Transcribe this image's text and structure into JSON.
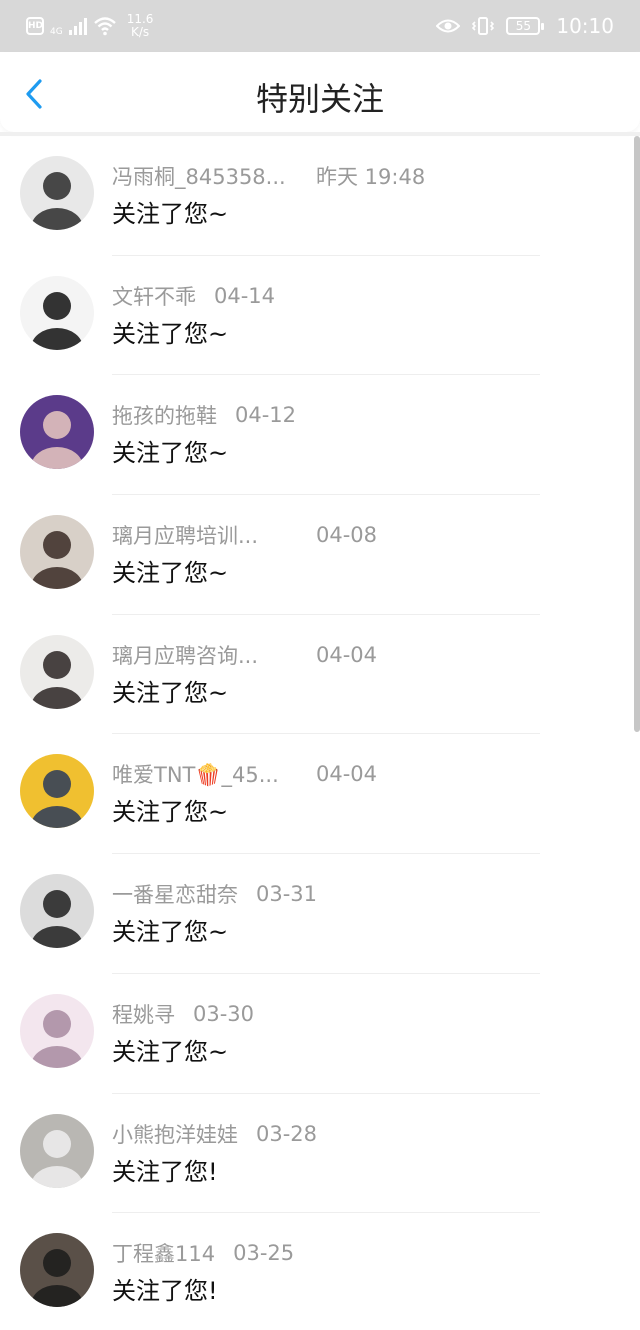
{
  "status_bar": {
    "hd": "HD",
    "network_type": "4G",
    "net_speed_value": "11.6",
    "net_speed_unit": "K/s",
    "battery": "55",
    "time": "10:10",
    "icons": [
      "hd-icon",
      "signal-icon",
      "wifi-icon",
      "eye-icon",
      "vibrate-icon",
      "battery-icon"
    ]
  },
  "header": {
    "title": "特别关注",
    "back_icon": "chevron-left-icon",
    "accent": "#1e9bf0"
  },
  "items": [
    {
      "name": "冯雨桐_845358...",
      "time": "昨天 19:48",
      "action": "关注了您~",
      "avatar_colors": [
        "#e8e8e8",
        "#2a2a2a"
      ]
    },
    {
      "name": "文轩不乖",
      "time": "04-14",
      "action": "关注了您~",
      "avatar_colors": [
        "#f4f4f4",
        "#111111"
      ]
    },
    {
      "name": "拖孩的拖鞋",
      "time": "04-12",
      "action": "关注了您~",
      "avatar_colors": [
        "#5b3b8a",
        "#e9c9c0"
      ]
    },
    {
      "name": "璃月应聘培训...",
      "time": "04-08",
      "action": "关注了您~",
      "avatar_colors": [
        "#d8d0c8",
        "#3a2a24"
      ]
    },
    {
      "name": "璃月应聘咨询...",
      "time": "04-04",
      "action": "关注了您~",
      "avatar_colors": [
        "#ecebe9",
        "#2b2423"
      ]
    },
    {
      "name": "唯爱TNT🍿_45...",
      "time": "04-04",
      "action": "关注了您~",
      "avatar_colors": [
        "#f0c030",
        "#2a3a5a"
      ]
    },
    {
      "name": "一番星恋甜奈",
      "time": "03-31",
      "action": "关注了您~",
      "avatar_colors": [
        "#dcdcdc",
        "#1e1e1e"
      ]
    },
    {
      "name": "程姚寻",
      "time": "03-30",
      "action": "关注了您~",
      "avatar_colors": [
        "#f3e6ee",
        "#a78aa0"
      ]
    },
    {
      "name": "小熊抱洋娃娃",
      "time": "03-28",
      "action": "关注了您!",
      "avatar_colors": [
        "#b9b7b3",
        "#efefef"
      ]
    },
    {
      "name": "丁程鑫114",
      "time": "03-25",
      "action": "关注了您!",
      "avatar_colors": [
        "#5a5048",
        "#1b1b1b"
      ]
    }
  ]
}
